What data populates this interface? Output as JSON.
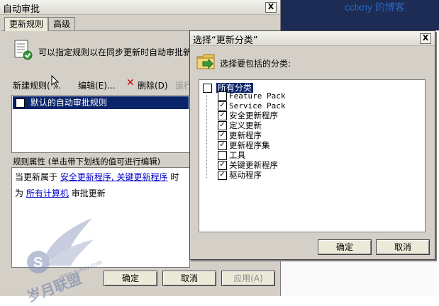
{
  "main_window": {
    "title": "自动审批",
    "close_glyph": "X",
    "tabs": [
      {
        "label": "更新规则"
      },
      {
        "label": "高级"
      }
    ],
    "description": "可以指定规则以在同步更新时自动审批新",
    "toolbar": {
      "new_rule": "新建规则(",
      "edit": "编辑(E)...",
      "delete": "删除(D)",
      "run": "运行"
    },
    "rules": [
      {
        "label": "默认的自动审批规则",
        "checked": false
      }
    ],
    "properties": {
      "header": "规则属性 (单击带下划线的值可进行编辑)",
      "line1_prefix": "当更新属于",
      "line1_link": "安全更新程序, 关键更新程序",
      "line1_suffix": "时",
      "line2_prefix": "为",
      "line2_link": "所有计算机",
      "line2_suffix": "审批更新"
    },
    "buttons": {
      "ok": "确定",
      "cancel": "取消",
      "apply": "应用(A)"
    }
  },
  "dialog": {
    "title": "选择“更新分类”",
    "close_glyph": "X",
    "prompt": "选择要包括的分类:",
    "root": {
      "label": "所有分类",
      "checked": false
    },
    "classifications": [
      {
        "label": "Feature Pack",
        "checked": false,
        "mono": true
      },
      {
        "label": "Service Pack",
        "checked": true,
        "mono": true
      },
      {
        "label": "安全更新程序",
        "checked": true
      },
      {
        "label": "定义更新",
        "checked": true
      },
      {
        "label": "更新程序",
        "checked": true
      },
      {
        "label": "更新程序集",
        "checked": true
      },
      {
        "label": "工具",
        "checked": false
      },
      {
        "label": "关键更新程序",
        "checked": true
      },
      {
        "label": "驱动程序",
        "checked": true
      }
    ],
    "buttons": {
      "ok": "确定",
      "cancel": "取消"
    }
  },
  "watermark": {
    "top_text": "cclxny 的博客",
    "logo_text": "岁月联盟",
    "logo_sub": "www.sysue.com"
  },
  "colors": {
    "selection": "#0a246a",
    "link": "#0000cc",
    "dialog_bg": "#d4d0c8"
  }
}
